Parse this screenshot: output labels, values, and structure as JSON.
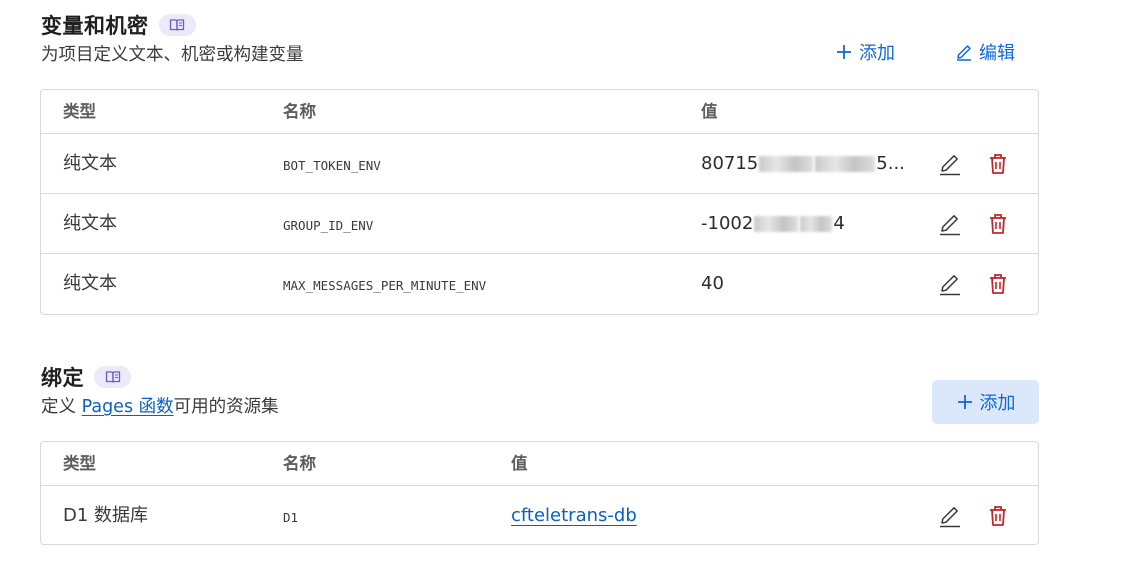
{
  "env_section": {
    "title": "变量和机密",
    "description": "为项目定义文本、机密或构建变量",
    "add_label": "添加",
    "edit_label": "编辑",
    "headers": {
      "type": "类型",
      "name": "名称",
      "value": "值"
    },
    "rows": [
      {
        "type": "纯文本",
        "name": "BOT_TOKEN_ENV",
        "value_prefix": "80715",
        "value_suffix": "5...",
        "redacted": true
      },
      {
        "type": "纯文本",
        "name": "GROUP_ID_ENV",
        "value_prefix": "-1002",
        "value_suffix": "4",
        "redacted": true
      },
      {
        "type": "纯文本",
        "name": "MAX_MESSAGES_PER_MINUTE_ENV",
        "value_prefix": "40",
        "value_suffix": "",
        "redacted": false
      }
    ]
  },
  "bindings_section": {
    "title": "绑定",
    "description_prefix": "定义 ",
    "description_link": "Pages 函数",
    "description_suffix": "可用的资源集",
    "add_label": "添加",
    "headers": {
      "type": "类型",
      "name": "名称",
      "value": "值"
    },
    "rows": [
      {
        "type": "D1 数据库",
        "name": "D1",
        "value": "cfteletrans-db"
      }
    ]
  },
  "icons": {
    "doc": "book-icon",
    "add": "plus-icon",
    "edit": "pencil-icon",
    "delete": "trash-icon"
  },
  "colors": {
    "accent": "#1168d6",
    "delete": "#c0272d",
    "badge_bg": "#ebe9fa",
    "add_btn_bg": "#dbe8fb"
  }
}
